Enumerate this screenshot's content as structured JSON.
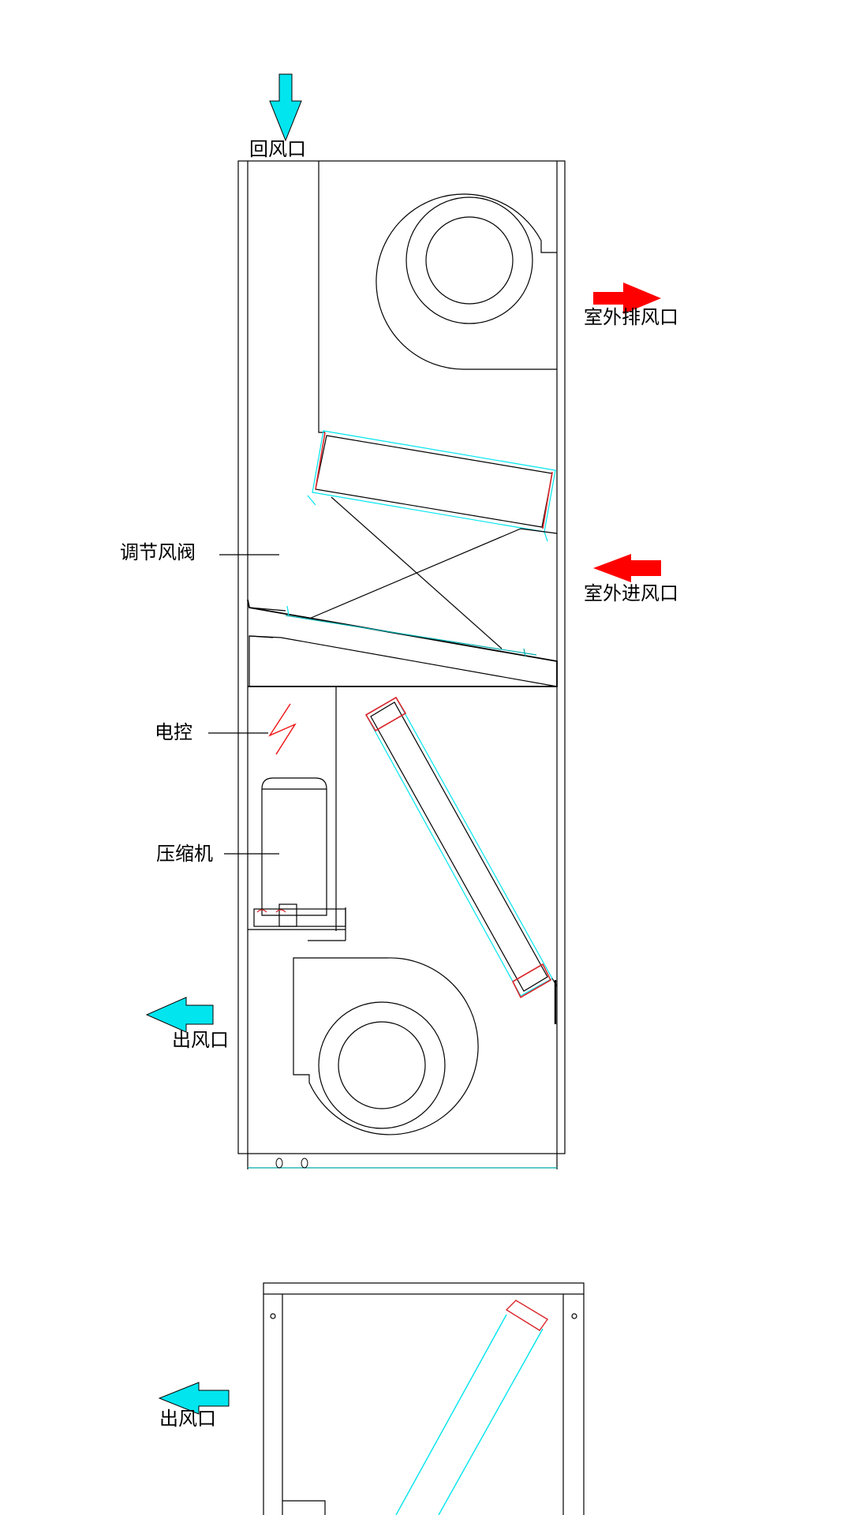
{
  "labels": {
    "return_air": "回风口",
    "outdoor_exhaust": "室外排风口",
    "outdoor_intake": "室外进风口",
    "damper": "调节风阀",
    "electric_control": "电控",
    "compressor": "压缩机",
    "supply_air": "出风口",
    "supply_air_lower": "出风口"
  },
  "colors": {
    "line": "#000000",
    "coil": "#00e5ee",
    "coil_frame": "#d9262b",
    "cold_arrow": "#00e5ee",
    "hot_arrow": "#ff0000"
  },
  "icons": {
    "return_arrow": "arrow-down-icon",
    "exhaust_arrow": "arrow-right-icon",
    "intake_arrow": "arrow-left-icon",
    "supply_arrow": "arrow-left-icon",
    "electric": "lightning-icon"
  }
}
